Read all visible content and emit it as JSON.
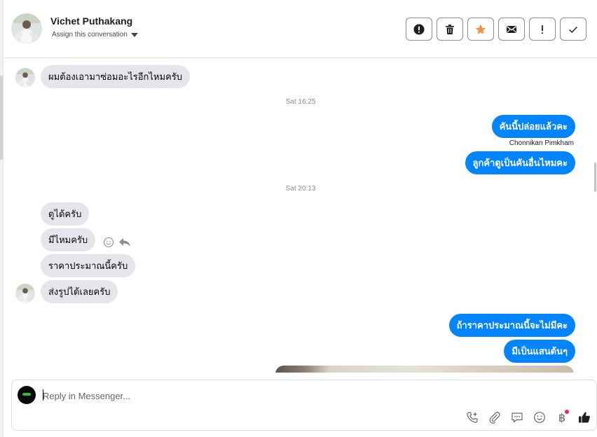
{
  "header": {
    "contact_name": "Vichet Puthakang",
    "assign_label": "Assign this conversation",
    "actions": [
      {
        "name": "spam-button",
        "icon": "exclamation-circle-icon"
      },
      {
        "name": "delete-button",
        "icon": "trash-icon"
      },
      {
        "name": "star-button",
        "icon": "star-icon",
        "color": "#f7923b"
      },
      {
        "name": "mark-unread-button",
        "icon": "envelope-icon"
      },
      {
        "name": "follow-up-button",
        "icon": "exclamation-icon"
      },
      {
        "name": "mark-done-button",
        "icon": "check-icon"
      }
    ]
  },
  "chat": {
    "messages_top": [
      {
        "from": "customer",
        "text": "ผมต้องเอามาซ่อมอะไรอีกไหมครับ"
      }
    ],
    "timestamp_1": "Sat 16:25",
    "outgoing_1": [
      {
        "text": "คันนี้ปล่อยแล้วคะ",
        "sender": "Chonnikan Pimkham"
      },
      {
        "text": "ลูกค้าดูเป็นคันอื่นไหมคะ"
      }
    ],
    "timestamp_2": "Sat 20:13",
    "incoming_2": [
      {
        "text": "ดูได้ครับ"
      },
      {
        "text": "มีไหมครับ"
      },
      {
        "text": "ราคาประมาณนี้ครับ"
      },
      {
        "text": "ส่งรูปได้เลยครับ"
      }
    ],
    "outgoing_2": [
      {
        "text": "ถ้าราคาประมาณนี้จะไม่มีคะ"
      },
      {
        "text": "มีเป็นแสนต้นๆ"
      }
    ],
    "message_actions": [
      "smiley-react-icon",
      "reply-arrow-icon"
    ]
  },
  "composer": {
    "placeholder": "Reply in Messenger...",
    "tools": [
      "phone-add-icon",
      "paperclip-icon",
      "chat-bubble-icon",
      "emoji-icon",
      "baht-icon",
      "thumbs-up-icon"
    ],
    "baht_symbol": "฿"
  },
  "colors": {
    "outgoing_bubble": "#0084ff",
    "incoming_bubble": "#e4e6eb",
    "star": "#f7923b",
    "notification_dot": "#f02849"
  }
}
